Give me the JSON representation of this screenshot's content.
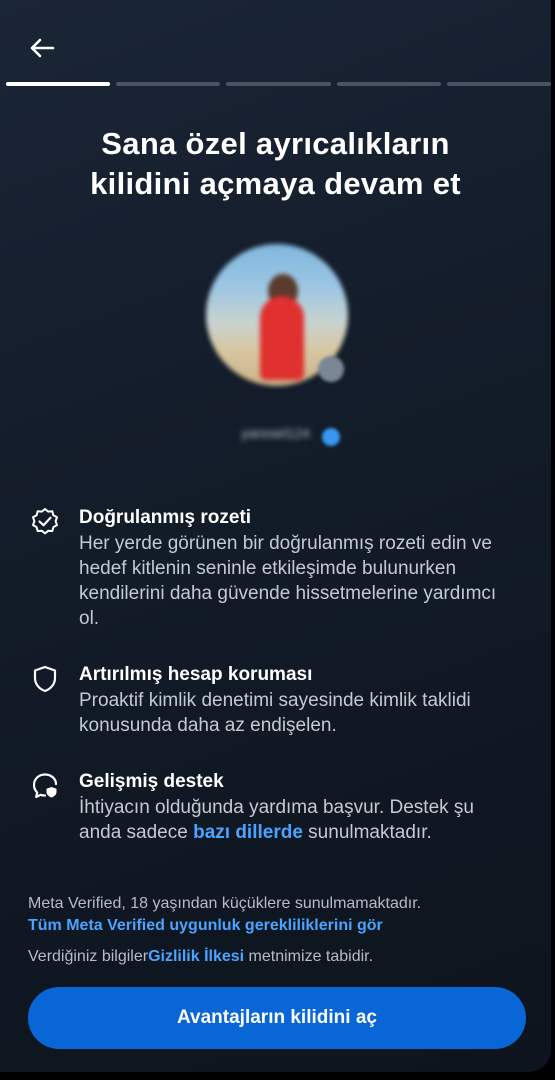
{
  "header": {
    "back_icon": "arrow-left-icon",
    "progress_segments": 5,
    "progress_active_index": 0
  },
  "title": {
    "line1": "Sana özel ayrıcalıkların",
    "line2": "kilidini açmaya devam et"
  },
  "profile": {
    "username": "yaresel124"
  },
  "features": [
    {
      "icon": "verified-badge-icon",
      "title": "Doğrulanmış rozeti",
      "description": "Her yerde görünen bir doğrulanmış rozeti edin ve hedef kitlenin seninle etkileşimde bulunurken kendilerini daha güvende hissetmelerine yardımcı ol."
    },
    {
      "icon": "shield-icon",
      "title": "Artırılmış hesap koruması",
      "description": "Proaktif kimlik denetimi sayesinde kimlik taklidi konusunda daha az endişelen."
    },
    {
      "icon": "support-shield-icon",
      "title": "Gelişmiş destek",
      "description_before": "İhtiyacın olduğunda yardıma başvur. Destek şu anda sadece ",
      "description_link": "bazı dillerde",
      "description_after": " sunulmaktadır."
    }
  ],
  "footer": {
    "age_notice": "Meta Verified, 18 yaşından küçüklere sunulmamaktadır.",
    "requirements_link": "Tüm Meta Verified uygunluk gerekliliklerini gör",
    "privacy_before": "Verdiğiniz bilgiler",
    "privacy_link": "Gizlilik İlkesi",
    "privacy_after": " metnimize tabidir."
  },
  "cta": {
    "label": "Avantajların kilidini aç"
  },
  "colors": {
    "accent": "#0866d6",
    "link": "#4aa3ff",
    "background": "#141d2b"
  }
}
